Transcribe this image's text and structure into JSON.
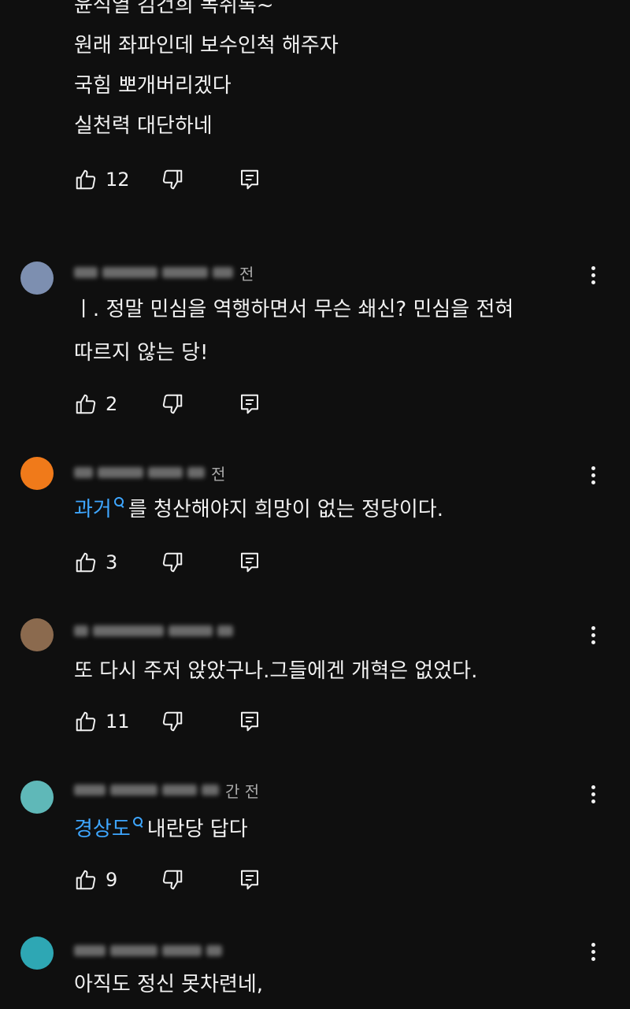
{
  "comments": [
    {
      "meta_suffix": "",
      "avatar_color": "#f26b7a",
      "lines": [
        [
          {
            "t": "윤석열 김건희 녹취록~"
          }
        ],
        [
          {
            "t": "원래 좌파인데 보수인척 해주자"
          }
        ],
        [
          {
            "t": "국힘 뽀개버리겠다"
          }
        ],
        [
          {
            "t": "실천력 대단하네"
          }
        ]
      ],
      "likes": "12"
    },
    {
      "meta_suffix": "전",
      "avatar_color": "#7d8fb0",
      "lines": [
        [
          {
            "t": "ㅣ. 정말 민심을 역행하면서 무슨 쇄신? 민심을 전혀"
          }
        ],
        [
          {
            "t": "따르지 않는 당!"
          }
        ]
      ],
      "likes": "2"
    },
    {
      "meta_suffix": "전",
      "avatar_color": "#f07a1a",
      "lines": [
        [
          {
            "t": "과거",
            "tag": true
          },
          {
            "t": "를 청산해야지 희망이 없는 정당이다."
          }
        ]
      ],
      "likes": "3"
    },
    {
      "meta_suffix": "",
      "avatar_color": "#8b6a4e",
      "lines": [
        [
          {
            "t": "또 다시 주저 앉았구나.그들에겐 개혁은 없었다."
          }
        ]
      ],
      "likes": "11"
    },
    {
      "meta_suffix": "간 전",
      "avatar_color": "#5fb8b8",
      "lines": [
        [
          {
            "t": "경상도",
            "tag": true
          },
          {
            "t": "내란당 답다"
          }
        ]
      ],
      "likes": "9"
    },
    {
      "meta_suffix": "",
      "avatar_color": "#2ea7b4",
      "lines": [
        [
          {
            "t": "아직도 정신 못차련네,"
          }
        ]
      ],
      "likes": ""
    }
  ],
  "icons": {
    "like": "thumbs-up-icon",
    "dislike": "thumbs-down-icon",
    "reply": "reply-icon",
    "more": "more-vert-icon",
    "hashtag_search": "search-icon"
  },
  "colors": {
    "background": "#0f0f0f",
    "text": "#f1f1f1",
    "link": "#3ea6ff",
    "muted": "#aaaaaa"
  }
}
